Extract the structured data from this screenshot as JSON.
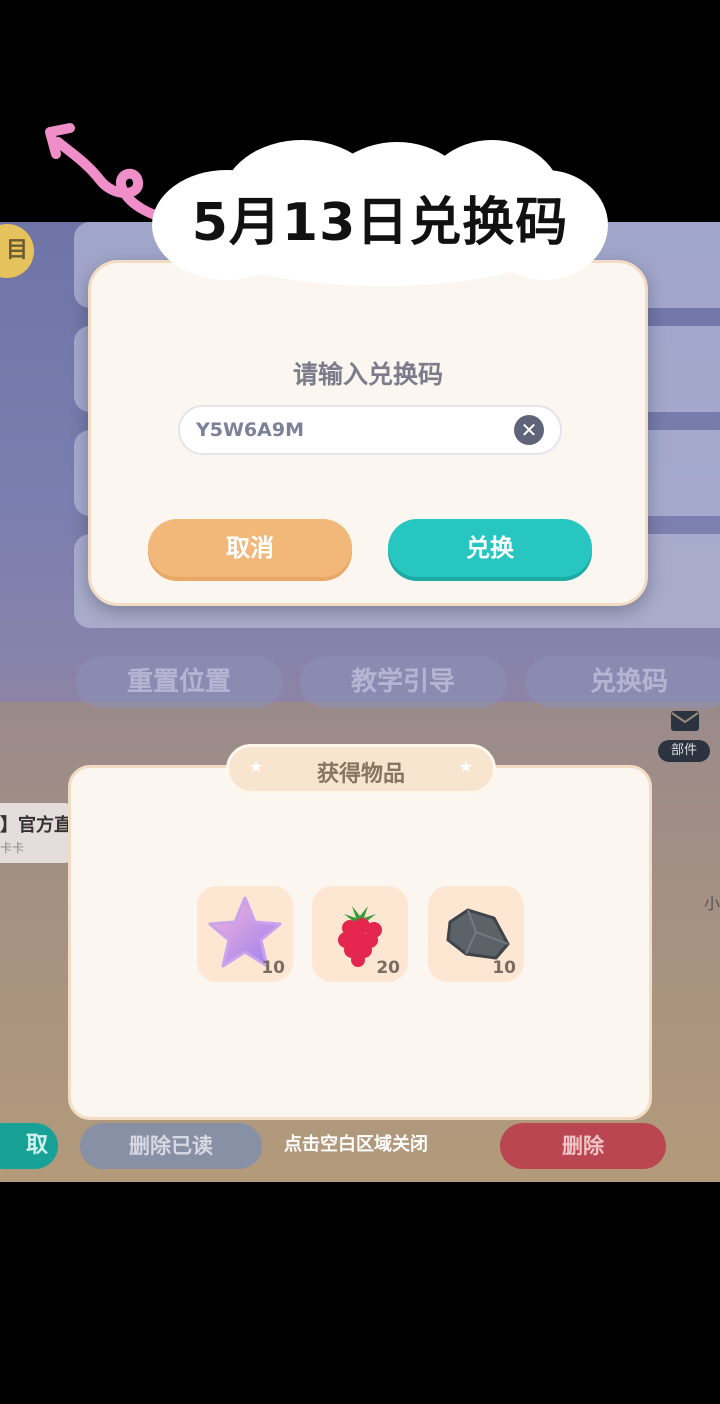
{
  "banner": {
    "title": "5月13日兑换码"
  },
  "background": {
    "yellow_tab_label": "目",
    "menu_buttons": [
      "重置位置",
      "教学引导",
      "兑换码"
    ],
    "mail_label": "部件",
    "side_title": "】官方直",
    "side_sub": "卡卡",
    "side_right": "小"
  },
  "redeem_dialog": {
    "title": "请输入兑换码",
    "code_value": "Y5W6A9M",
    "cancel_label": "取消",
    "confirm_label": "兑换"
  },
  "reward_dialog": {
    "title": "获得物品",
    "items": [
      {
        "icon": "star-icon",
        "count": "10"
      },
      {
        "icon": "raspberry-icon",
        "count": "20"
      },
      {
        "icon": "stone-icon",
        "count": "10"
      }
    ]
  },
  "bottom_bar": {
    "left_partial": "取",
    "delete_read": "删除已读",
    "hint": "点击空白区域关闭",
    "delete": "删除"
  }
}
